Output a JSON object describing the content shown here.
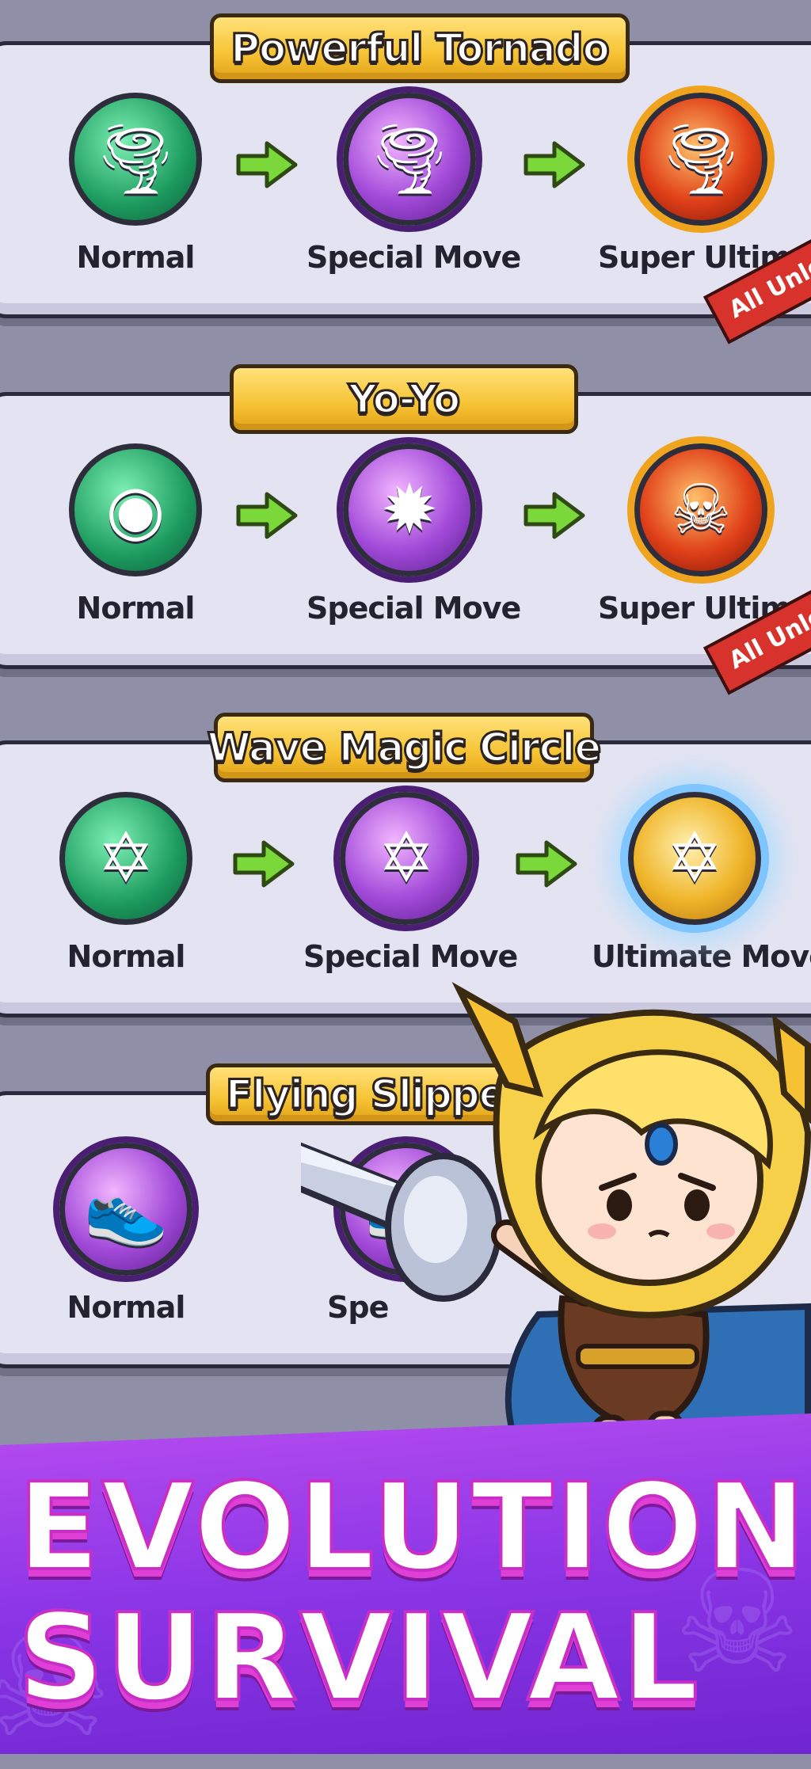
{
  "cards": [
    {
      "title": "Powerful Tornado",
      "stages": [
        {
          "label": "Normal",
          "style": "green",
          "icon": "tornado-icon",
          "glyph": "🌪"
        },
        {
          "label": "Special Move",
          "style": "purple",
          "icon": "tornado-icon",
          "glyph": "🌪"
        },
        {
          "label": "Super Ultimate",
          "style": "red",
          "icon": "dark-tornado-icon",
          "glyph": "🌪"
        }
      ],
      "ribbon": "All Unlo"
    },
    {
      "title": "Yo-Yo",
      "stages": [
        {
          "label": "Normal",
          "style": "green",
          "icon": "yoyo-icon",
          "glyph": "◉"
        },
        {
          "label": "Special Move",
          "style": "purple",
          "icon": "spiked-ball-icon",
          "glyph": "✹"
        },
        {
          "label": "Super Ultimate",
          "style": "red",
          "icon": "skull-icon",
          "glyph": "☠"
        }
      ],
      "ribbon": "All Unlo"
    },
    {
      "title": "Wave Magic Circle",
      "stages": [
        {
          "label": "Normal",
          "style": "green",
          "icon": "hexagram-icon",
          "glyph": "✡"
        },
        {
          "label": "Special Move",
          "style": "purple",
          "icon": "hexagram-icon",
          "glyph": "✡"
        },
        {
          "label": "Ultimate Move",
          "style": "gold",
          "icon": "hexagram-icon",
          "glyph": "✡"
        }
      ]
    },
    {
      "title": "Flying Slipper",
      "stages": [
        {
          "label": "Normal",
          "style": "purple",
          "icon": "slipper-icon",
          "glyph": "👟"
        },
        {
          "label": "Spe",
          "style": "purple",
          "icon": "slipper-icon",
          "glyph": "👟"
        }
      ]
    }
  ],
  "headline": {
    "line1": "EVOLUTION",
    "line2": "SURVIVAL"
  },
  "colors": {
    "accent_arrow": "#7ad83a",
    "headline_stroke": "#c92ec7",
    "banner": "#f6c233"
  }
}
